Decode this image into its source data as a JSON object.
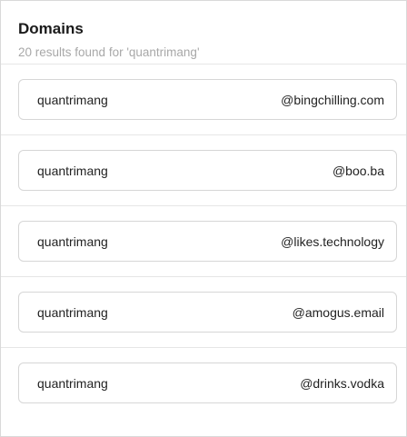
{
  "header": {
    "title": "Domains",
    "subtitle": "20 results found for 'quantrimang'"
  },
  "results": [
    {
      "name": "quantrimang",
      "domain": "@bingchilling.com"
    },
    {
      "name": "quantrimang",
      "domain": "@boo.ba"
    },
    {
      "name": "quantrimang",
      "domain": "@likes.technology"
    },
    {
      "name": "quantrimang",
      "domain": "@amogus.email"
    },
    {
      "name": "quantrimang",
      "domain": "@drinks.vodka"
    }
  ]
}
